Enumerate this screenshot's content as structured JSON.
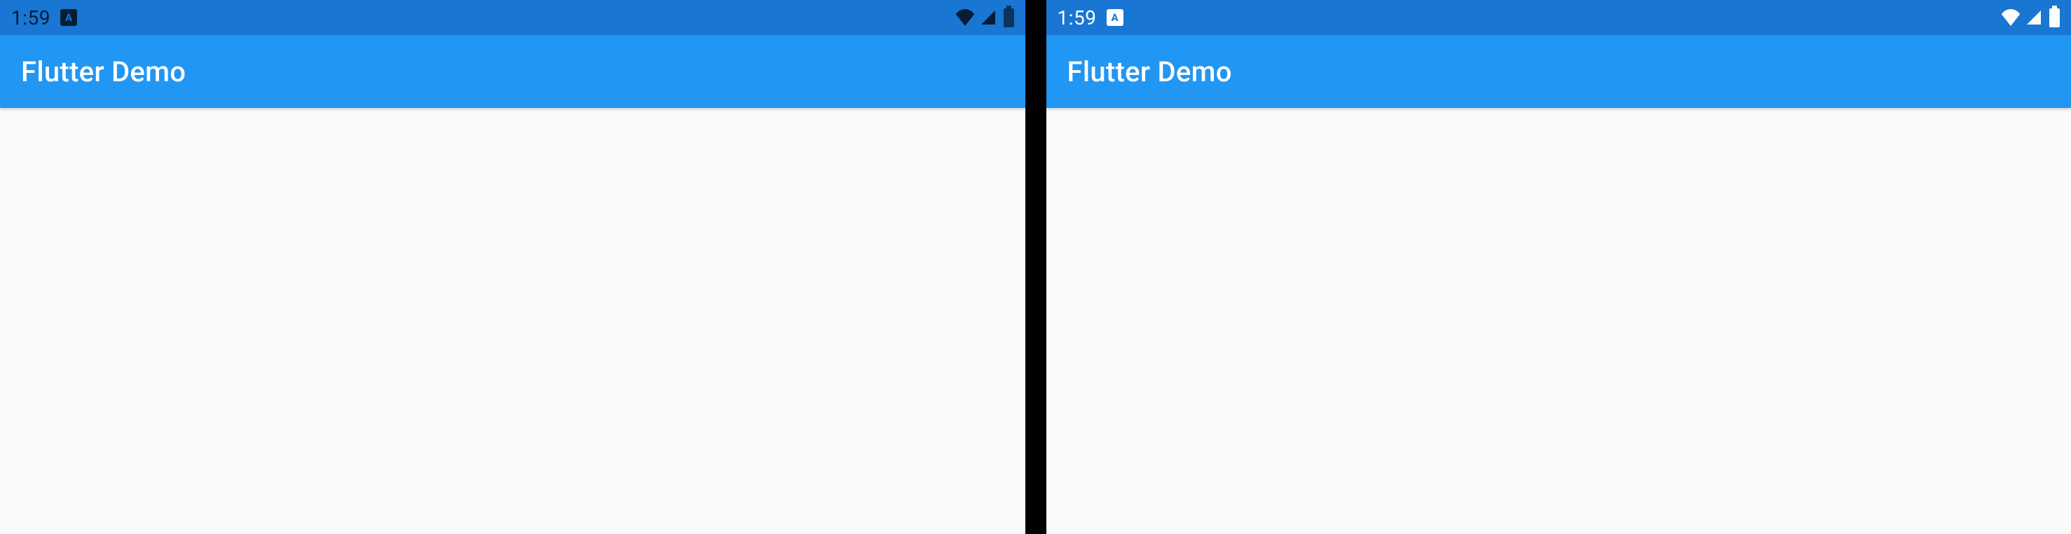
{
  "screens": {
    "left": {
      "statusBar": {
        "time": "1:59",
        "badge": "A",
        "iconColor": "dark"
      },
      "appBar": {
        "title": "Flutter Demo"
      }
    },
    "right": {
      "statusBar": {
        "time": "1:59",
        "badge": "A",
        "iconColor": "light"
      },
      "appBar": {
        "title": "Flutter Demo"
      }
    }
  },
  "colors": {
    "statusBarBg": "#1976d2",
    "appBarBg": "#2196f3",
    "bodyBg": "#fafafa"
  }
}
